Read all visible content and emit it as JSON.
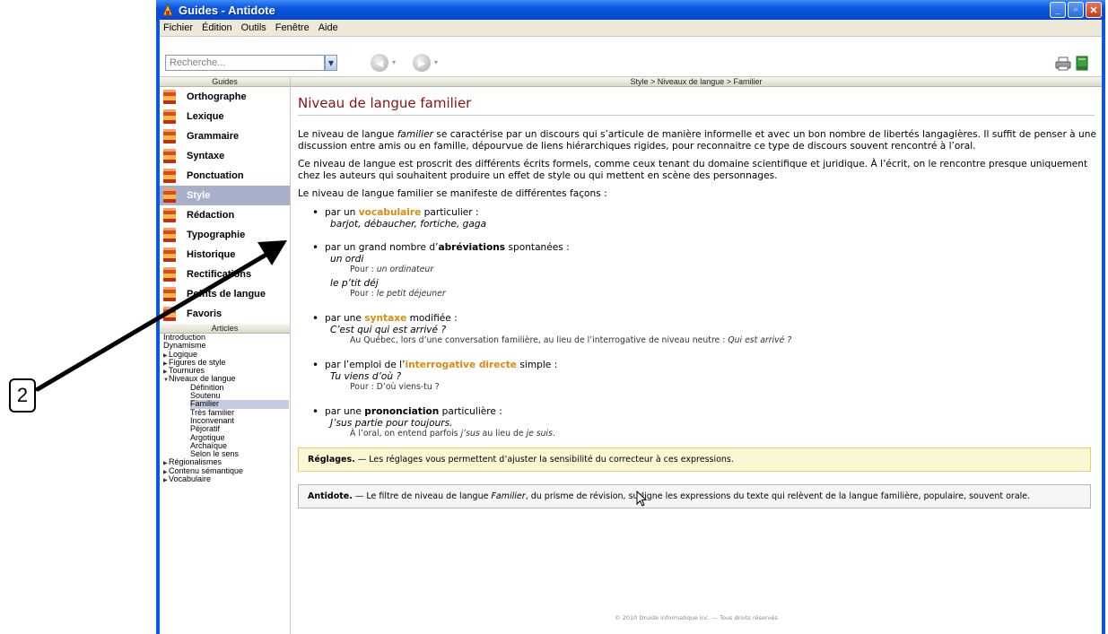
{
  "window": {
    "title": "Guides - Antidote"
  },
  "menu": [
    "Fichier",
    "Édition",
    "Outils",
    "Fenêtre",
    "Aide"
  ],
  "toolbar": {
    "search_placeholder": "Recherche..."
  },
  "sidebar": {
    "guides_header": "Guides",
    "guides": [
      {
        "label": "Orthographe"
      },
      {
        "label": "Lexique"
      },
      {
        "label": "Grammaire"
      },
      {
        "label": "Syntaxe"
      },
      {
        "label": "Ponctuation"
      },
      {
        "label": "Style",
        "active": true
      },
      {
        "label": "Rédaction"
      },
      {
        "label": "Typographie"
      },
      {
        "label": "Historique"
      },
      {
        "label": "Rectifications"
      },
      {
        "label": "Points de langue"
      },
      {
        "label": "Favoris"
      }
    ],
    "articles_header": "Articles",
    "articles": [
      {
        "label": "Introduction",
        "level": 0
      },
      {
        "label": "Dynamisme",
        "level": 0
      },
      {
        "label": "Logique",
        "level": 0,
        "expander": "collapsed"
      },
      {
        "label": "Figures de style",
        "level": 0,
        "expander": "collapsed"
      },
      {
        "label": "Tournures",
        "level": 0,
        "expander": "collapsed"
      },
      {
        "label": "Niveaux de langue",
        "level": 0,
        "expander": "expanded"
      },
      {
        "label": "Définition",
        "level": 1
      },
      {
        "label": "Soutenu",
        "level": 1
      },
      {
        "label": "Familier",
        "level": 1,
        "active": true
      },
      {
        "label": "Très familier",
        "level": 1
      },
      {
        "label": "Inconvenant",
        "level": 1
      },
      {
        "label": "Péjoratif",
        "level": 1
      },
      {
        "label": "Argotique",
        "level": 1
      },
      {
        "label": "Archaïque",
        "level": 1
      },
      {
        "label": "Selon le sens",
        "level": 1
      },
      {
        "label": "Régionalismes",
        "level": 0,
        "expander": "collapsed"
      },
      {
        "label": "Contenu sémantique",
        "level": 0,
        "expander": "collapsed"
      },
      {
        "label": "Vocabulaire",
        "level": 0,
        "expander": "collapsed"
      }
    ]
  },
  "content": {
    "breadcrumb": "Style > Niveaux de langue > Familier",
    "title": "Niveau de langue familier",
    "p1_a": "Le niveau de langue ",
    "p1_em": "familier",
    "p1_b": " se caractérise par un discours qui s’articule de manière informelle et avec un bon nombre de libertés langagières. Il suffit de penser à une discussion entre amis ou en famille, dépourvue de liens hiérarchiques rigides, pour reconnaitre ce type de discours souvent rencontré à l’oral.",
    "p2": "Ce niveau de langue est proscrit des différents écrits formels, comme ceux tenant du domaine scientifique et juridique. À l’écrit, on le rencontre presque uniquement chez les auteurs qui souhaitent produire un effet de style ou qui mettent en scène des personnages.",
    "p3": "Le niveau de langue familier se manifeste de différentes façons :",
    "b1_pre": "par un ",
    "b1_kw": "vocabulaire",
    "b1_post": " particulier :",
    "b1_ex": "barjot, débaucher, fortiche, gaga",
    "b2_pre": "par un grand nombre d’",
    "b2_kw": "abréviations",
    "b2_post": " spontanées :",
    "b2_ex1": "un ordi",
    "b2_pour": "Pour : ",
    "b2_ex1_note": "un ordinateur",
    "b2_ex2": "le p’tit déj",
    "b2_ex2_note": "le petit déjeuner",
    "b3_pre": "par une ",
    "b3_kw": "syntaxe",
    "b3_post": " modifiée :",
    "b3_ex": "C’est qui qui est arrivé ?",
    "b3_note_a": "Au Québec, lors d’une conversation familière, au lieu de l’interrogative de niveau neutre : ",
    "b3_note_em": "Qui est arrivé ?",
    "b4_pre": "par l’emploi de l’",
    "b4_kw": "interrogative directe",
    "b4_post": " simple :",
    "b4_ex": "Tu viens d’où ?",
    "b4_note": "Pour : D’où viens-tu ?",
    "b5_pre": "par une ",
    "b5_kw": "prononciation",
    "b5_post": " particulière :",
    "b5_ex": "J’sus partie pour toujours.",
    "b5_note_a": "À l’oral, on entend parfois ",
    "b5_note_em1": "j’sus",
    "b5_note_b": " au lieu de ",
    "b5_note_em2": "je suis",
    "b5_note_c": ".",
    "box1_label": "Réglages.",
    "box1_text": " — Les réglages vous permettent d’ajuster la sensibilité du correcteur à ces expressions.",
    "box2_label": "Antidote.",
    "box2_text_a": " — Le filtre de niveau de langue ",
    "box2_text_em": "Familier",
    "box2_text_b": ", du prisme de révision, surligne les expressions du texte qui relèvent de la langue familière, populaire, souvent orale.",
    "footer": "© 2010 Druide informatique inc. — Tous droits réservés"
  },
  "annotation": {
    "callout_number": "2"
  },
  "colors": {
    "title_red": "#8b1010",
    "keyword_orange": "#d98b10",
    "active_guide": "#a7b0c8",
    "window_blue": "#0a5ae0"
  }
}
